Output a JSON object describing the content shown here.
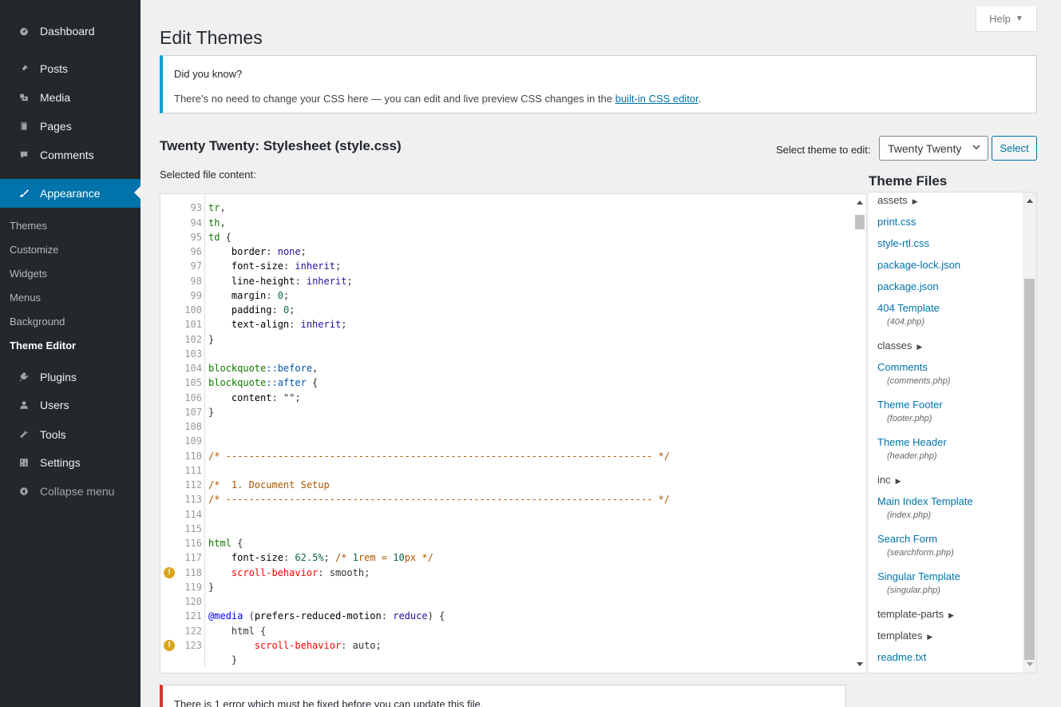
{
  "sidebar": {
    "items": [
      {
        "label": "Dashboard",
        "icon": "dashboard-icon"
      },
      {
        "label": "Posts",
        "icon": "pin-icon"
      },
      {
        "label": "Media",
        "icon": "media-icon"
      },
      {
        "label": "Pages",
        "icon": "pages-icon"
      },
      {
        "label": "Comments",
        "icon": "comment-icon"
      },
      {
        "label": "Appearance",
        "icon": "brush-icon"
      },
      {
        "label": "Plugins",
        "icon": "plugin-icon"
      },
      {
        "label": "Users",
        "icon": "user-icon"
      },
      {
        "label": "Tools",
        "icon": "wrench-icon"
      },
      {
        "label": "Settings",
        "icon": "settings-icon"
      },
      {
        "label": "Collapse menu",
        "icon": "collapse-icon"
      }
    ],
    "submenu": [
      "Themes",
      "Customize",
      "Widgets",
      "Menus",
      "Background",
      "Theme Editor"
    ],
    "current": "Appearance",
    "current_sub": "Theme Editor"
  },
  "help_tab": {
    "label": "Help"
  },
  "page_title": "Edit Themes",
  "notice": {
    "heading": "Did you know?",
    "text_before": "There’s no need to change your CSS here — you can edit and live preview CSS changes in the ",
    "link": "built-in CSS editor",
    "text_after": "."
  },
  "file_heading": "Twenty Twenty: Stylesheet (style.css)",
  "theme_select": {
    "label": "Select theme to edit:",
    "value": "Twenty Twenty",
    "button": "Select"
  },
  "selected_file_label": "Selected file content:",
  "theme_files": {
    "heading": "Theme Files",
    "items": [
      {
        "label": "assets",
        "type": "folder"
      },
      {
        "label": "print.css",
        "type": "file"
      },
      {
        "label": "style-rtl.css",
        "type": "file"
      },
      {
        "label": "package-lock.json",
        "type": "file"
      },
      {
        "label": "package.json",
        "type": "file"
      },
      {
        "label": "404 Template",
        "sub": "(404.php)",
        "type": "file"
      },
      {
        "label": "classes",
        "type": "folder"
      },
      {
        "label": "Comments",
        "sub": "(comments.php)",
        "type": "file"
      },
      {
        "label": "Theme Footer",
        "sub": "(footer.php)",
        "type": "file"
      },
      {
        "label": "Theme Header",
        "sub": "(header.php)",
        "type": "file"
      },
      {
        "label": "inc",
        "type": "folder"
      },
      {
        "label": "Main Index Template",
        "sub": "(index.php)",
        "type": "file"
      },
      {
        "label": "Search Form",
        "sub": "(searchform.php)",
        "type": "file"
      },
      {
        "label": "Singular Template",
        "sub": "(singular.php)",
        "type": "file"
      },
      {
        "label": "template-parts",
        "type": "folder"
      },
      {
        "label": "templates",
        "type": "folder"
      },
      {
        "label": "readme.txt",
        "type": "file"
      }
    ]
  },
  "code_lines": [
    {
      "n": "",
      "text": ""
    },
    {
      "n": "93",
      "text": "tr,"
    },
    {
      "n": "94",
      "text": "th,"
    },
    {
      "n": "95",
      "text": "td {"
    },
    {
      "n": "96",
      "text": "    border: none;"
    },
    {
      "n": "97",
      "text": "    font-size: inherit;"
    },
    {
      "n": "98",
      "text": "    line-height: inherit;"
    },
    {
      "n": "99",
      "text": "    margin: 0;"
    },
    {
      "n": "100",
      "text": "    padding: 0;"
    },
    {
      "n": "101",
      "text": "    text-align: inherit;"
    },
    {
      "n": "102",
      "text": "}"
    },
    {
      "n": "103",
      "text": ""
    },
    {
      "n": "104",
      "text": "blockquote::before,"
    },
    {
      "n": "105",
      "text": "blockquote::after {"
    },
    {
      "n": "106",
      "text": "    content: \"\";"
    },
    {
      "n": "107",
      "text": "}"
    },
    {
      "n": "108",
      "text": ""
    },
    {
      "n": "109",
      "text": ""
    },
    {
      "n": "110",
      "text": "/* -------------------------------------------------------------------------- */"
    },
    {
      "n": "111",
      "text": ""
    },
    {
      "n": "112",
      "text": "/*  1. Document Setup"
    },
    {
      "n": "113",
      "text": "/* -------------------------------------------------------------------------- */"
    },
    {
      "n": "114",
      "text": ""
    },
    {
      "n": "115",
      "text": ""
    },
    {
      "n": "116",
      "text": "html {"
    },
    {
      "n": "117",
      "text": "    font-size: 62.5%; /* 1rem = 10px */"
    },
    {
      "n": "118",
      "text": "    scroll-behavior: smooth;",
      "warn": true
    },
    {
      "n": "119",
      "text": "}"
    },
    {
      "n": "120",
      "text": ""
    },
    {
      "n": "121",
      "text": "@media (prefers-reduced-motion: reduce) {"
    },
    {
      "n": "122",
      "text": "    html {"
    },
    {
      "n": "123",
      "text": "        scroll-behavior: auto;",
      "warn": true
    },
    {
      "n": "",
      "text": "    }"
    }
  ],
  "error_notice": "There is 1 error which must be fixed before you can update this file."
}
